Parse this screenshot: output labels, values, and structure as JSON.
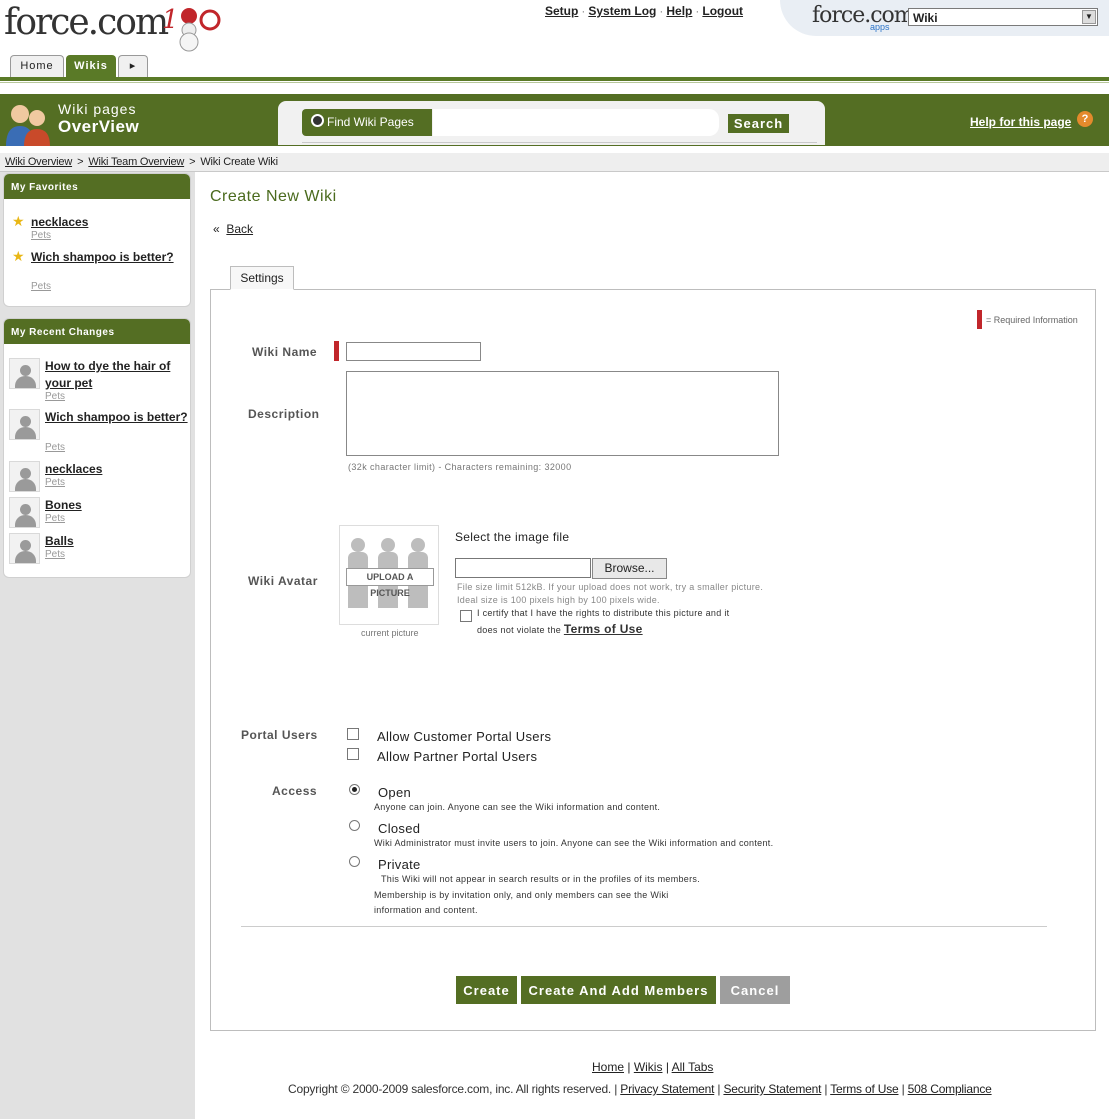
{
  "header": {
    "logo_text": "force.com",
    "top_links": [
      "Setup",
      "System Log",
      "Help",
      "Logout"
    ],
    "app_logo": "force.com",
    "app_logo_sub": "apps",
    "app_selector_value": "Wiki",
    "tabs": [
      {
        "label": "Home",
        "active": false
      },
      {
        "label": "Wikis",
        "active": true
      }
    ]
  },
  "band": {
    "title_line1": "Wiki pages",
    "title_line2": "OverView",
    "search_label": "Find Wiki Pages",
    "search_value": "",
    "search_button": "Search",
    "help_link": "Help for this page",
    "help_icon": "question-icon"
  },
  "breadcrumb": [
    "Wiki Overview",
    "Wiki Team Overview",
    "Wiki Create Wiki"
  ],
  "breadcrumb_sep": ">",
  "sidebar": {
    "favorites": {
      "title": "My Favorites",
      "items": [
        {
          "title": "necklaces",
          "category": "Pets"
        },
        {
          "title": "Wich shampoo is better?",
          "category": "Pets"
        }
      ]
    },
    "recent": {
      "title": "My Recent Changes",
      "items": [
        {
          "title": "How to dye the hair of your pet",
          "category": "Pets"
        },
        {
          "title": "Wich shampoo is better?",
          "category": "Pets"
        },
        {
          "title": "necklaces",
          "category": "Pets"
        },
        {
          "title": "Bones",
          "category": "Pets"
        },
        {
          "title": "Balls",
          "category": "Pets"
        }
      ]
    }
  },
  "main": {
    "title": "Create New Wiki",
    "back_prefix": "«",
    "back_label": "Back",
    "tab_label": "Settings",
    "required_legend": "= Required Information",
    "wiki_name_label": "Wiki Name",
    "wiki_name_value": "",
    "description_label": "Description",
    "description_value": "",
    "char_limit": "(32k character limit) - Characters remaining:  32000",
    "avatar_label": "Wiki Avatar",
    "upload_picture_label": "UPLOAD A PICTURE",
    "current_picture": "current picture",
    "select_image_label": "Select the image file",
    "browse_label": "Browse...",
    "file_hint_1": "File size limit 512kB. If your upload does not work, try a smaller picture.",
    "file_hint_2": "Ideal size is 100 pixels high by 100 pixels wide.",
    "certify_text_1": "I certify that I have the rights to distribute this picture and it",
    "certify_text_2": "does not violate the",
    "terms_link": "Terms of Use",
    "portal_label": "Portal Users",
    "portal_options": [
      {
        "label": "Allow Customer Portal Users",
        "checked": false
      },
      {
        "label": "Allow Partner Portal Users",
        "checked": false
      }
    ],
    "access_label": "Access",
    "access_options": [
      {
        "label": "Open",
        "selected": true,
        "desc": "Anyone can join. Anyone can see the Wiki information and content."
      },
      {
        "label": "Closed",
        "selected": false,
        "desc": "Wiki Administrator must invite users to join. Anyone can see the Wiki information and content."
      },
      {
        "label": "Private",
        "selected": false,
        "desc_1": "This Wiki will not appear in search results or in the profiles of its members.",
        "desc_2": "Membership is by invitation only, and only members can see the Wiki",
        "desc_3": "information and content."
      }
    ],
    "buttons": {
      "create": "Create",
      "create_add": "Create And Add Members",
      "cancel": "Cancel"
    }
  },
  "footer": {
    "links": [
      "Home",
      "Wikis",
      "All Tabs"
    ],
    "copyright": "Copyright © 2000-2009 salesforce.com, inc. All rights reserved. |",
    "legal_links": [
      "Privacy Statement",
      "Security Statement",
      "Terms of Use",
      "508 Compliance"
    ]
  },
  "colors": {
    "brand_green": "#546e23",
    "required_red": "#c1262b",
    "cancel_gray": "#9e9e9e"
  }
}
